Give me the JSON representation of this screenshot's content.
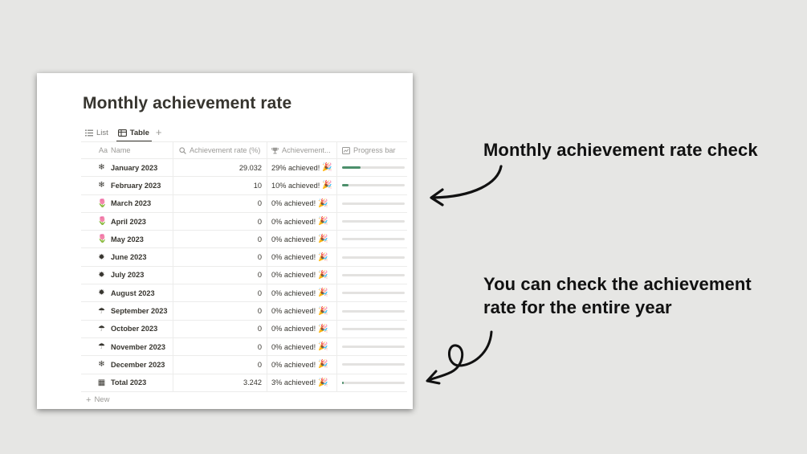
{
  "page": {
    "title": "Monthly achievement rate",
    "views": [
      {
        "label": "List",
        "icon": "list-icon"
      },
      {
        "label": "Table",
        "icon": "table-icon"
      }
    ],
    "add_view_label": "+",
    "new_row_label": "New"
  },
  "table": {
    "columns": [
      {
        "icon": "Aa",
        "label": "Name"
      },
      {
        "icon": "search-icon",
        "label": "Achievement rate (%)"
      },
      {
        "icon": "trophy-icon",
        "label": "Achievement..."
      },
      {
        "icon": "chart-icon",
        "label": "Progress bar"
      }
    ],
    "rows": [
      {
        "icon": "❄",
        "icon_name": "snowflake-icon",
        "name": "January 2023",
        "rate": "29.032",
        "achievement": "29% achieved!",
        "progress": 0.29
      },
      {
        "icon": "❄",
        "icon_name": "snowflake-icon",
        "name": "February 2023",
        "rate": "10",
        "achievement": "10% achieved!",
        "progress": 0.1
      },
      {
        "icon": "🌷",
        "icon_name": "tulip-icon",
        "name": "March 2023",
        "rate": "0",
        "achievement": "0% achieved!",
        "progress": 0
      },
      {
        "icon": "🌷",
        "icon_name": "tulip-icon",
        "name": "April 2023",
        "rate": "0",
        "achievement": "0% achieved!",
        "progress": 0
      },
      {
        "icon": "🌷",
        "icon_name": "tulip-icon",
        "name": "May 2023",
        "rate": "0",
        "achievement": "0% achieved!",
        "progress": 0
      },
      {
        "icon": "✹",
        "icon_name": "sun-icon",
        "name": "June 2023",
        "rate": "0",
        "achievement": "0% achieved!",
        "progress": 0
      },
      {
        "icon": "✹",
        "icon_name": "sun-icon",
        "name": "July 2023",
        "rate": "0",
        "achievement": "0% achieved!",
        "progress": 0
      },
      {
        "icon": "✹",
        "icon_name": "sun-icon",
        "name": "August 2023",
        "rate": "0",
        "achievement": "0% achieved!",
        "progress": 0
      },
      {
        "icon": "☂",
        "icon_name": "mushroom-icon",
        "name": "September 2023",
        "rate": "0",
        "achievement": "0% achieved!",
        "progress": 0
      },
      {
        "icon": "☂",
        "icon_name": "mushroom-icon",
        "name": "October 2023",
        "rate": "0",
        "achievement": "0% achieved!",
        "progress": 0
      },
      {
        "icon": "☂",
        "icon_name": "mushroom-icon",
        "name": "November 2023",
        "rate": "0",
        "achievement": "0% achieved!",
        "progress": 0
      },
      {
        "icon": "❄",
        "icon_name": "snowflake-icon",
        "name": "December 2023",
        "rate": "0",
        "achievement": "0% achieved!",
        "progress": 0
      },
      {
        "icon": "▦",
        "icon_name": "calendar-icon",
        "name": "Total 2023",
        "rate": "3.242",
        "achievement": "3% achieved!",
        "progress": 0.03
      }
    ],
    "party_icon": "🎉"
  },
  "callouts": {
    "first": "Monthly achievement rate check",
    "second_line1": "You can check the achievement",
    "second_line2": "rate for the entire year"
  },
  "colors": {
    "background": "#e6e6e4",
    "progress_fill": "#4c8f6b",
    "progress_track": "#e3e2e0",
    "text": "#37352f"
  }
}
